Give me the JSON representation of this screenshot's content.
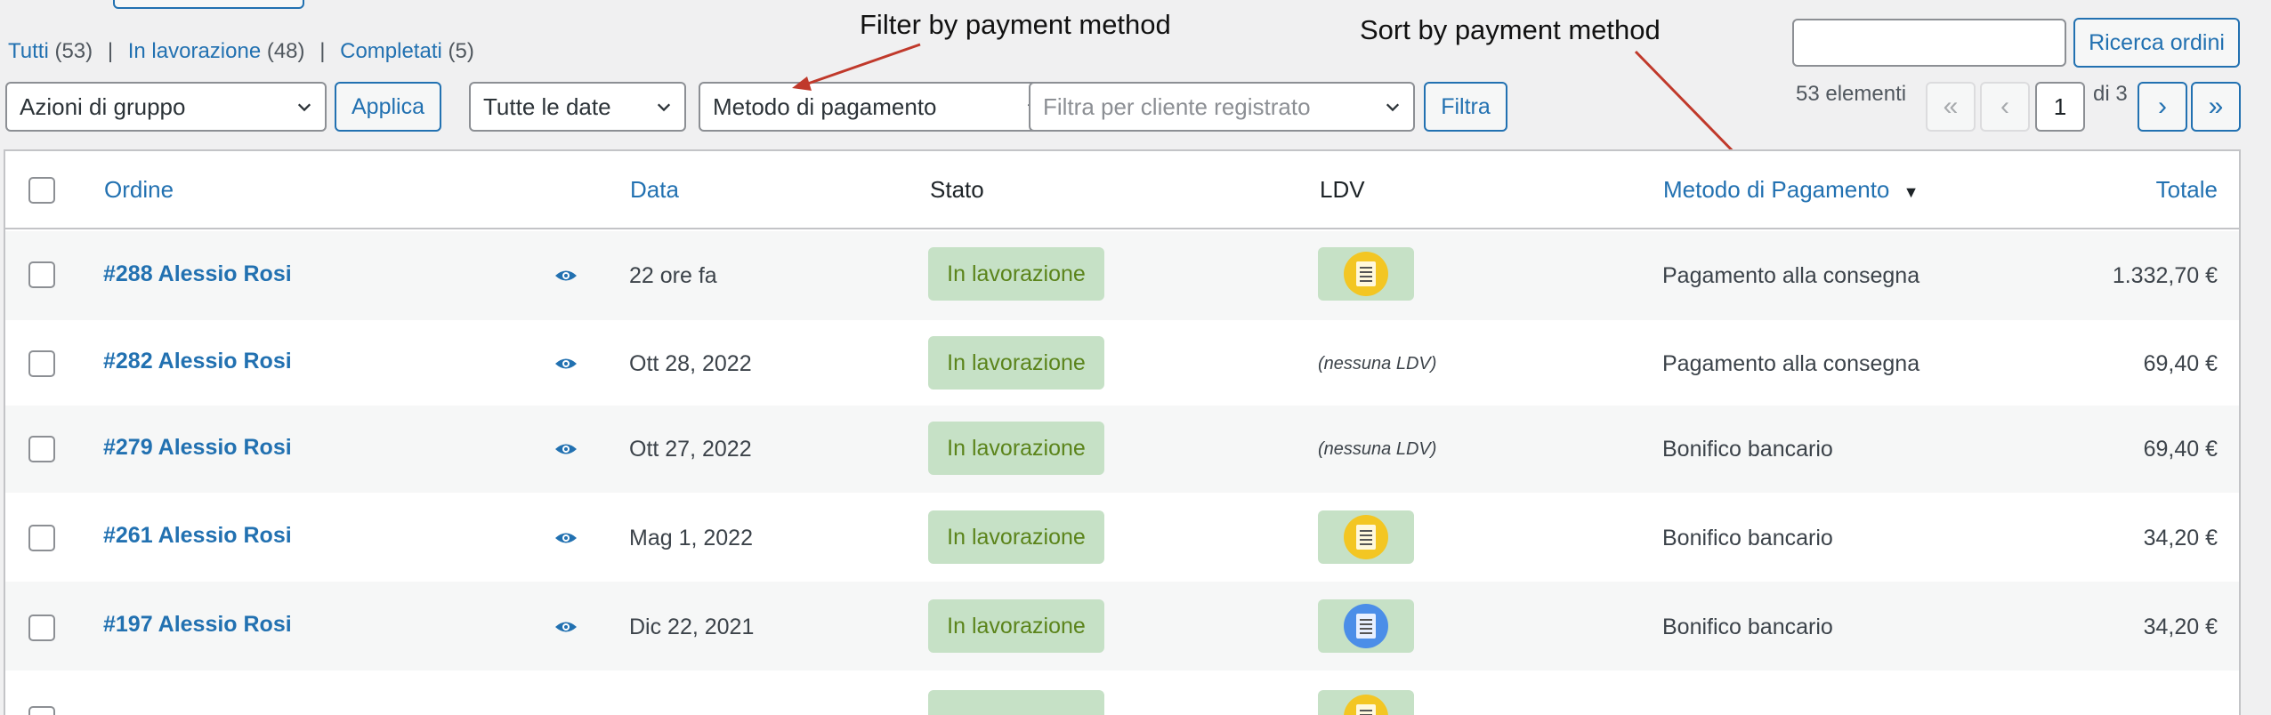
{
  "header": {
    "status_links": [
      {
        "label": "Tutti",
        "count": "(53)"
      },
      {
        "label": "In lavorazione",
        "count": "(48)"
      },
      {
        "label": "Completati",
        "count": "(5)"
      }
    ],
    "search_button": "Ricerca ordini",
    "search_value": ""
  },
  "filters": {
    "bulk_actions": "Azioni di gruppo",
    "apply": "Applica",
    "dates": "Tutte le date",
    "payment_method": "Metodo di pagamento",
    "customer_placeholder": "Filtra per cliente registrato",
    "filter": "Filtra"
  },
  "pagination": {
    "items": "53 elementi",
    "first": "«",
    "prev": "‹",
    "current": "1",
    "of": "di 3",
    "next": "›",
    "last": "»"
  },
  "annotations": {
    "filter_note": "Filter by payment method",
    "sort_note": "Sort by payment method",
    "color": "#c0392b"
  },
  "table": {
    "columns": {
      "order": "Ordine",
      "date": "Data",
      "status": "Stato",
      "ldv": "LDV",
      "payment": "Metodo di Pagamento",
      "total": "Totale"
    },
    "sort_indicator": "▼",
    "rows": [
      {
        "order": "#288 Alessio Rosi",
        "date": "22 ore fa",
        "status": "In lavorazione",
        "ldv": "yellow-document-icon",
        "ldv_text": "",
        "payment": "Pagamento alla consegna",
        "total": "1.332,70 €"
      },
      {
        "order": "#282 Alessio Rosi",
        "date": "Ott 28, 2022",
        "status": "In lavorazione",
        "ldv": "",
        "ldv_text": "(nessuna LDV)",
        "payment": "Pagamento alla consegna",
        "total": "69,40 €"
      },
      {
        "order": "#279 Alessio Rosi",
        "date": "Ott 27, 2022",
        "status": "In lavorazione",
        "ldv": "",
        "ldv_text": "(nessuna LDV)",
        "payment": "Bonifico bancario",
        "total": "69,40 €"
      },
      {
        "order": "#261 Alessio Rosi",
        "date": "Mag 1, 2022",
        "status": "In lavorazione",
        "ldv": "yellow-document-icon",
        "ldv_text": "",
        "payment": "Bonifico bancario",
        "total": "34,20 €"
      },
      {
        "order": "#197 Alessio Rosi",
        "date": "Dic 22, 2021",
        "status": "In lavorazione",
        "ldv": "blue-document-icon",
        "ldv_text": "",
        "payment": "Bonifico bancario",
        "total": "34,20 €"
      }
    ]
  },
  "colors": {
    "link": "#2271b1",
    "status_bg": "#c6e1c6",
    "status_text": "#5b841b"
  }
}
